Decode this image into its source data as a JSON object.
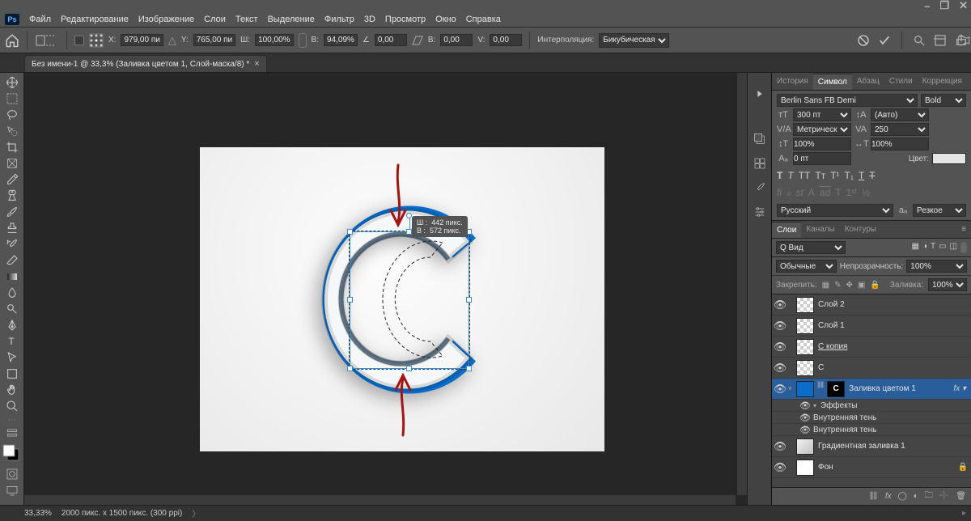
{
  "window_controls": [
    "–",
    "❐",
    "✕"
  ],
  "menubar": [
    "Файл",
    "Редактирование",
    "Изображение",
    "Слои",
    "Текст",
    "Выделение",
    "Фильтр",
    "3D",
    "Просмотр",
    "Окно",
    "Справка"
  ],
  "optbar": {
    "X_label": "X:",
    "X": "979,00 пи",
    "Y_label": "Y:",
    "Y": "765,00 пи",
    "W_label": "Ш:",
    "W": "100,00%",
    "H_label": "В:",
    "H": "94,09%",
    "angle_label": "∠",
    "angle": "0,00",
    "skewH_label": "В:",
    "skewH": "0,00",
    "skewV_label": "V:",
    "skewV": "0,00",
    "interp_label": "Интерполяция:",
    "interp": "Бикубическая"
  },
  "tab": {
    "title": "Без имени-1 @ 33,3% (Заливка цветом 1, Слой-маска/8) *"
  },
  "measure": {
    "w_lbl": "Ш :",
    "w": "442 пикс.",
    "h_lbl": "В :",
    "h": "572 пикс."
  },
  "panels": {
    "group1": {
      "tabs": [
        "История",
        "Символ",
        "Абзац",
        "Стили",
        "Коррекция"
      ],
      "active": 1
    },
    "char": {
      "font": "Berlin Sans FB Demi",
      "style": "Bold",
      "size": "300 пт",
      "leading": "(Авто)",
      "kerning": "Метрически",
      "tracking": "250",
      "vscale": "100%",
      "hscale": "100%",
      "baseline": "0 пт",
      "color_label": "Цвет:",
      "lang": "Русский",
      "aa": "Резкое"
    },
    "group2": {
      "tabs": [
        "Слои",
        "Каналы",
        "Контуры"
      ],
      "active": 0
    },
    "layers": {
      "kind": "Q Вид",
      "blend": "Обычные",
      "opacity_label": "Непрозрачность:",
      "opacity": "100%",
      "lock_label": "Закрепить:",
      "fill_label": "Заливка:",
      "fill": "100%",
      "items": [
        {
          "name": "Слой 2",
          "thumb": "checker"
        },
        {
          "name": "Слой 1",
          "thumb": "checker"
        },
        {
          "name": "С копия",
          "thumb": "checker",
          "underline": true
        },
        {
          "name": "C",
          "thumb": "checker"
        },
        {
          "name": "Заливка цветом 1",
          "thumb": "blue",
          "mask": true,
          "active": true,
          "fx": true,
          "caret": true
        },
        {
          "name": "Градиентная заливка 1",
          "thumb": "grad"
        },
        {
          "name": "Фон",
          "thumb": "white",
          "lock": true
        }
      ],
      "fx": {
        "label": "Эффекты",
        "items": [
          "Внутренняя тень",
          "Внутренняя тень"
        ]
      }
    }
  },
  "status": {
    "zoom": "33,33%",
    "doc": "2000 пикс. x 1500 пикс. (300 ppi)"
  }
}
